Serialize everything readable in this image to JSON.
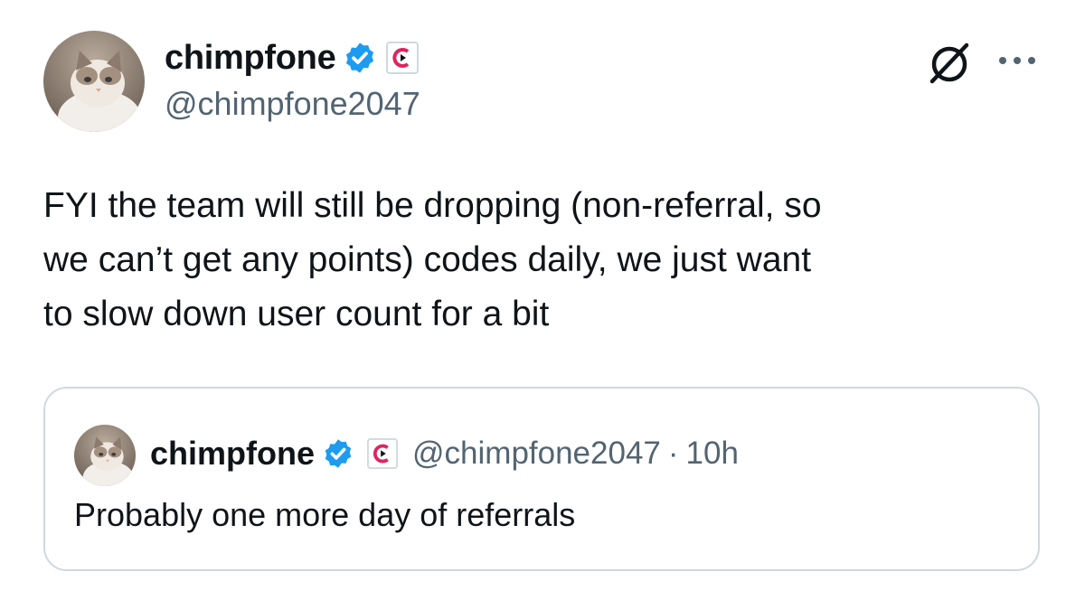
{
  "post": {
    "author": {
      "name": "chimpfone",
      "handle": "@chimpfone2047",
      "avatar": "cat-avatar",
      "verified_icon": "verified-badge-icon",
      "affiliation_icon": "affiliate-logo-icon"
    },
    "actions": {
      "grok_icon": "grok-icon",
      "more_icon": "more-options-icon"
    },
    "text": "FYI the team will still be dropping (non-referral, so\nwe can’t get any points) codes daily, we just want\nto slow down user count for a bit"
  },
  "quote": {
    "author": {
      "name": "chimpfone",
      "handle": "@chimpfone2047",
      "avatar": "cat-avatar"
    },
    "separator": "·",
    "time": "10h",
    "text": "Probably one more day of referrals"
  },
  "colors": {
    "text": "#0f1419",
    "secondary": "#536471",
    "verified": "#1d9bf0",
    "border": "#cfd9de",
    "affiliate_red": "#e0245e"
  }
}
